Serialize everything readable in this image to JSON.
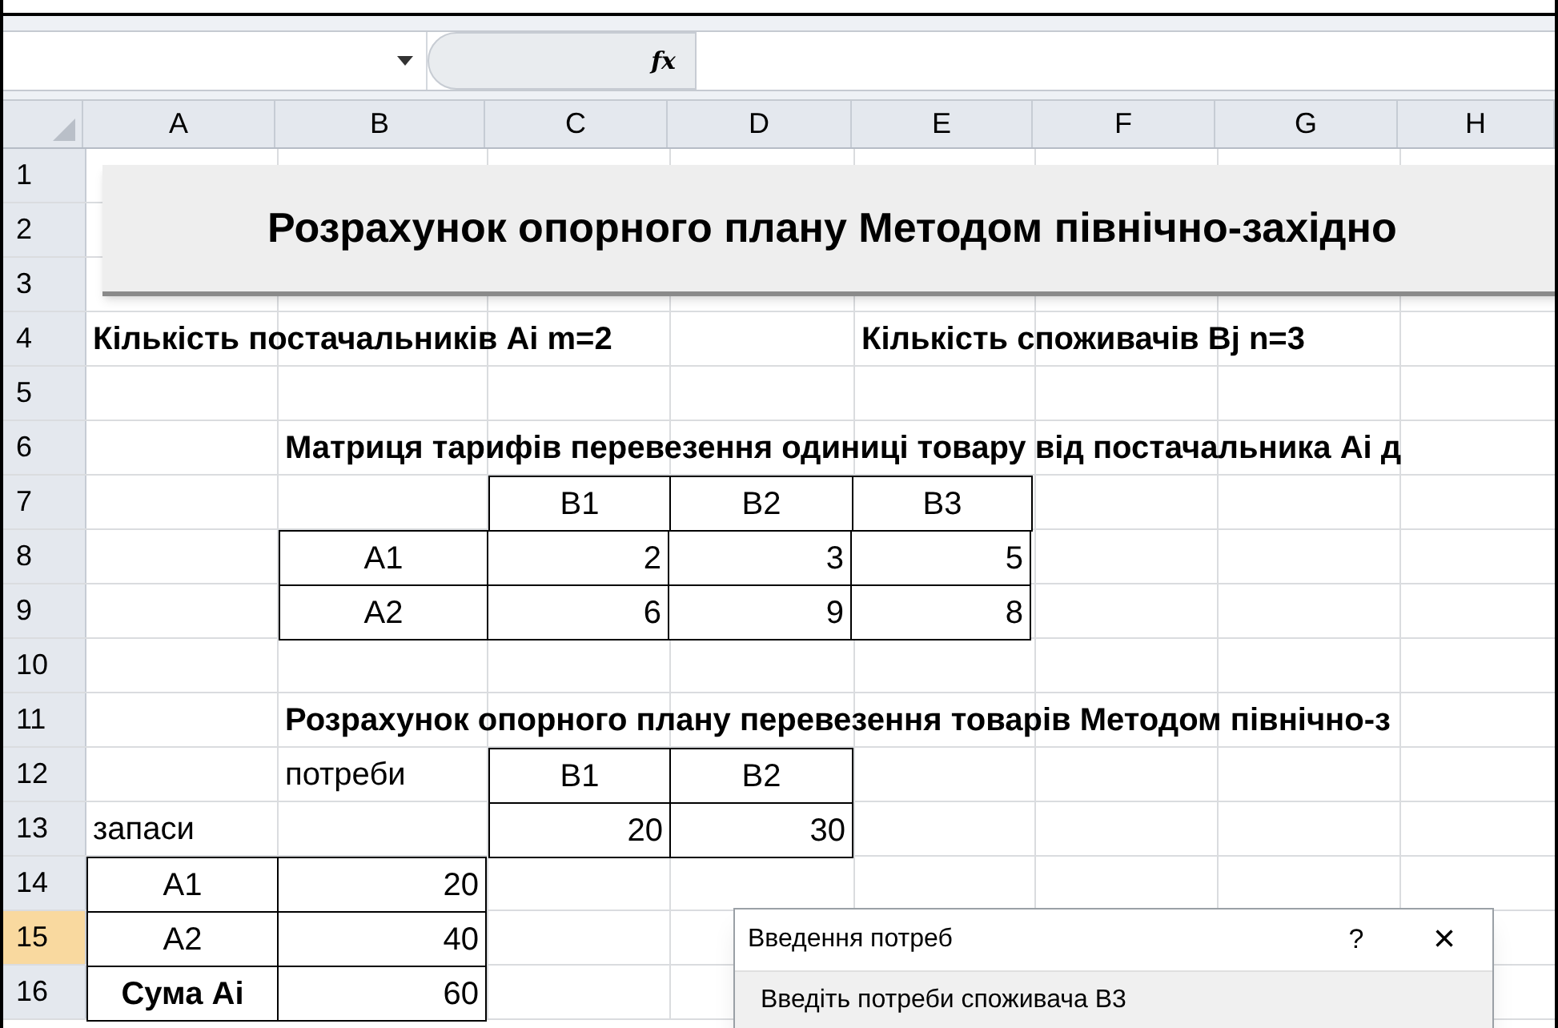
{
  "formula_bar": {
    "fx_label": "fx"
  },
  "columns": [
    {
      "label": "A",
      "selected": false
    },
    {
      "label": "B",
      "selected": false
    },
    {
      "label": "C",
      "selected": false
    },
    {
      "label": "D",
      "selected": false
    },
    {
      "label": "E",
      "selected": false
    },
    {
      "label": "F",
      "selected": false
    },
    {
      "label": "G",
      "selected": false
    },
    {
      "label": "H",
      "selected": false
    }
  ],
  "title_banner": {
    "text": "Розрахунок опорного плану Методом північно-західно"
  },
  "rows": [
    {
      "number": "1",
      "selected": false,
      "cells": [
        {},
        {},
        {},
        {},
        {},
        {},
        {},
        {}
      ]
    },
    {
      "number": "2",
      "selected": false,
      "cells": [
        {},
        {},
        {},
        {},
        {},
        {},
        {},
        {}
      ]
    },
    {
      "number": "3",
      "selected": false,
      "cells": [
        {},
        {},
        {},
        {},
        {},
        {},
        {},
        {}
      ]
    },
    {
      "number": "4",
      "selected": false,
      "cells": [
        {
          "text": "Кількість постачальників Ai  m=2",
          "bold": true,
          "kind": "label"
        },
        {},
        {},
        {},
        {
          "text": "Кількість споживачів Bj  n=3",
          "bold": true,
          "kind": "label"
        },
        {},
        {},
        {}
      ]
    },
    {
      "number": "5",
      "selected": false,
      "cells": [
        {},
        {},
        {},
        {},
        {},
        {},
        {},
        {}
      ]
    },
    {
      "number": "6",
      "selected": false,
      "cells": [
        {},
        {
          "text": "Матриця тарифів перевезення одиниці товару від постачальника Ai д",
          "bold": true,
          "kind": "label"
        },
        {},
        {},
        {},
        {},
        {},
        {}
      ]
    },
    {
      "number": "7",
      "selected": false,
      "cells": [
        {},
        {},
        {
          "text": "B1",
          "kind": "header",
          "bordered": true
        },
        {
          "text": "B2",
          "kind": "header",
          "bordered": true
        },
        {
          "text": "B3",
          "kind": "header",
          "bordered": true
        },
        {},
        {},
        {}
      ]
    },
    {
      "number": "8",
      "selected": false,
      "cells": [
        {},
        {
          "text": "A1",
          "kind": "header",
          "bordered": true
        },
        {
          "text": "2",
          "kind": "number",
          "bordered": true
        },
        {
          "text": "3",
          "kind": "number",
          "bordered": true
        },
        {
          "text": "5",
          "kind": "number",
          "bordered": true
        },
        {},
        {},
        {}
      ]
    },
    {
      "number": "9",
      "selected": false,
      "cells": [
        {},
        {
          "text": "A2",
          "kind": "header",
          "bordered": true
        },
        {
          "text": "6",
          "kind": "number",
          "bordered": true
        },
        {
          "text": "9",
          "kind": "number",
          "bordered": true
        },
        {
          "text": "8",
          "kind": "number",
          "bordered": true
        },
        {},
        {},
        {}
      ]
    },
    {
      "number": "10",
      "selected": false,
      "cells": [
        {},
        {},
        {},
        {},
        {},
        {},
        {},
        {}
      ]
    },
    {
      "number": "11",
      "selected": false,
      "cells": [
        {},
        {
          "text": "Розрахунок опорного плану перевезення товарів Методом північно-з",
          "bold": true,
          "kind": "label"
        },
        {},
        {},
        {},
        {},
        {},
        {}
      ]
    },
    {
      "number": "12",
      "selected": false,
      "cells": [
        {},
        {
          "text": "потреби",
          "kind": "label"
        },
        {
          "text": "B1",
          "kind": "header",
          "bordered": true
        },
        {
          "text": "B2",
          "kind": "header",
          "bordered": true
        },
        {},
        {},
        {},
        {}
      ]
    },
    {
      "number": "13",
      "selected": false,
      "cells": [
        {
          "text": "запаси",
          "kind": "label"
        },
        {},
        {
          "text": "20",
          "kind": "number",
          "bordered": true
        },
        {
          "text": "30",
          "kind": "number",
          "bordered": true
        },
        {},
        {},
        {},
        {}
      ]
    },
    {
      "number": "14",
      "selected": false,
      "cells": [
        {
          "text": "A1",
          "kind": "header",
          "bordered": true
        },
        {
          "text": "20",
          "kind": "number",
          "bordered": true
        },
        {},
        {},
        {},
        {},
        {},
        {}
      ]
    },
    {
      "number": "15",
      "selected": true,
      "cells": [
        {
          "text": "A2",
          "kind": "header",
          "bordered": true
        },
        {
          "text": "40",
          "kind": "number",
          "bordered": true
        },
        {},
        {},
        {},
        {},
        {},
        {}
      ]
    },
    {
      "number": "16",
      "selected": false,
      "cells": [
        {
          "text": "Сума Ai",
          "bold": true,
          "kind": "header",
          "bordered": true
        },
        {
          "text": "60",
          "kind": "number",
          "bordered": true
        },
        {},
        {},
        {},
        {},
        {},
        {}
      ]
    }
  ],
  "dialog": {
    "title": "Введення потреб",
    "help": "?",
    "close": "×",
    "prompt": "Введіть потреби споживача В3"
  }
}
